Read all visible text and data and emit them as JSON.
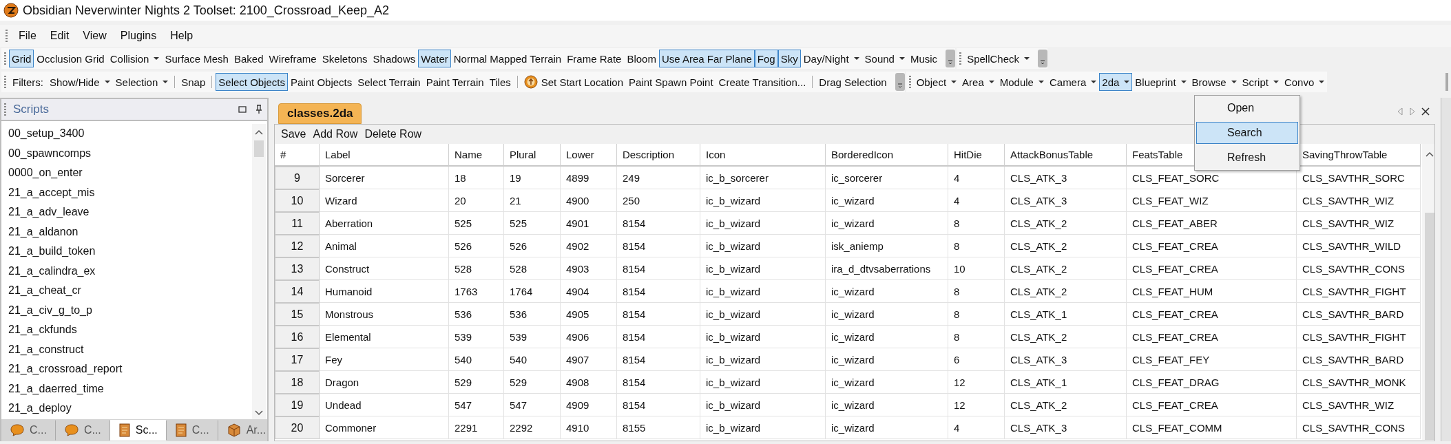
{
  "window": {
    "title": "Obsidian Neverwinter Nights 2 Toolset: 2100_Crossroad_Keep_A2"
  },
  "menu_bar": [
    "File",
    "Edit",
    "View",
    "Plugins",
    "Help"
  ],
  "toolbar_rows": [
    {
      "toolbars": [
        {
          "items": [
            {
              "kind": "toggle",
              "label": "Grid",
              "selected": true
            },
            {
              "kind": "toggle",
              "label": "Occlusion Grid",
              "selected": false
            },
            {
              "kind": "dropdown",
              "label": "Collision",
              "selected": false
            },
            {
              "kind": "toggle",
              "label": "Surface Mesh",
              "selected": false
            },
            {
              "kind": "toggle",
              "label": "Baked",
              "selected": false
            },
            {
              "kind": "toggle",
              "label": "Wireframe",
              "selected": false
            },
            {
              "kind": "toggle",
              "label": "Skeletons",
              "selected": false
            },
            {
              "kind": "toggle",
              "label": "Shadows",
              "selected": false
            },
            {
              "kind": "toggle",
              "label": "Water",
              "selected": true
            },
            {
              "kind": "toggle",
              "label": "Normal Mapped Terrain",
              "selected": false
            },
            {
              "kind": "toggle",
              "label": "Frame Rate",
              "selected": false
            },
            {
              "kind": "toggle",
              "label": "Bloom",
              "selected": false
            },
            {
              "kind": "toggle",
              "label": "Use Area Far Plane",
              "selected": true
            },
            {
              "kind": "toggle",
              "label": "Fog",
              "selected": true
            },
            {
              "kind": "toggle",
              "label": "Sky",
              "selected": true
            },
            {
              "kind": "dropdown",
              "label": "Day/Night",
              "selected": false
            },
            {
              "kind": "dropdown",
              "label": "Sound",
              "selected": false
            },
            {
              "kind": "toggle",
              "label": "Music",
              "selected": false
            },
            {
              "kind": "overflow"
            }
          ]
        },
        {
          "items": [
            {
              "kind": "dropdown",
              "label": "SpellCheck",
              "selected": false
            },
            {
              "kind": "overflow"
            }
          ]
        }
      ]
    },
    {
      "toolbars": [
        {
          "items": [
            {
              "kind": "label",
              "label": "Filters:"
            },
            {
              "kind": "dropdown",
              "label": "Show/Hide",
              "selected": false
            },
            {
              "kind": "dropdown",
              "label": "Selection",
              "selected": false
            },
            {
              "kind": "separator"
            },
            {
              "kind": "toggle",
              "label": "Snap",
              "selected": false
            },
            {
              "kind": "separator"
            },
            {
              "kind": "toggle",
              "label": "Select Objects",
              "selected": true
            },
            {
              "kind": "toggle",
              "label": "Paint Objects",
              "selected": false
            },
            {
              "kind": "toggle",
              "label": "Select Terrain",
              "selected": false
            },
            {
              "kind": "toggle",
              "label": "Paint Terrain",
              "selected": false
            },
            {
              "kind": "toggle",
              "label": "Tiles",
              "selected": false
            },
            {
              "kind": "separator"
            },
            {
              "kind": "icon-button",
              "label": "Set Start Location",
              "selected": false
            },
            {
              "kind": "toggle",
              "label": "Paint Spawn Point",
              "selected": false
            },
            {
              "kind": "toggle",
              "label": "Create Transition...",
              "selected": false
            },
            {
              "kind": "separator"
            },
            {
              "kind": "toggle",
              "label": "Drag Selection",
              "selected": false
            },
            {
              "kind": "overflow"
            }
          ]
        },
        {
          "items": [
            {
              "kind": "dropdown",
              "label": "Object",
              "selected": false
            },
            {
              "kind": "dropdown",
              "label": "Area",
              "selected": false
            },
            {
              "kind": "dropdown",
              "label": "Module",
              "selected": false
            },
            {
              "kind": "dropdown",
              "label": "Camera",
              "selected": false
            },
            {
              "kind": "dropdown",
              "label": "2da",
              "selected": true
            },
            {
              "kind": "dropdown",
              "label": "Blueprint",
              "selected": false
            },
            {
              "kind": "dropdown",
              "label": "Browse",
              "selected": false
            },
            {
              "kind": "dropdown",
              "label": "Script",
              "selected": false
            },
            {
              "kind": "dropdown",
              "label": "Convo",
              "selected": false
            }
          ]
        }
      ]
    }
  ],
  "dropdown_menu": [
    {
      "label": "Open",
      "selected": false
    },
    {
      "label": "Search",
      "selected": true
    },
    {
      "label": "Refresh",
      "selected": false
    }
  ],
  "scripts_panel": {
    "title": "Scripts",
    "items": [
      "00_setup_3400",
      "00_spawncomps",
      "0000_on_enter",
      "21_a_accept_mis",
      "21_a_adv_leave",
      "21_a_aldanon",
      "21_a_build_token",
      "21_a_calindra_ex",
      "21_a_cheat_cr",
      "21_a_civ_g_to_p",
      "21_a_ckfunds",
      "21_a_construct",
      "21_a_crossroad_report",
      "21_a_daerred_time",
      "21_a_deploy"
    ],
    "tabs": [
      {
        "label": "C...",
        "kind": "bubble",
        "selected": false
      },
      {
        "label": "C...",
        "kind": "bubble",
        "selected": false
      },
      {
        "label": "Sc...",
        "kind": "script",
        "selected": true
      },
      {
        "label": "C...",
        "kind": "script",
        "selected": false
      },
      {
        "label": "Ar...",
        "kind": "box",
        "selected": false
      }
    ]
  },
  "document": {
    "tabs": [
      {
        "label": "classes.2da",
        "selected": true
      }
    ],
    "actions": [
      "Save",
      "Add Row",
      "Delete Row"
    ],
    "table": {
      "columns": [
        "#",
        "Label",
        "Name",
        "Plural",
        "Lower",
        "Description",
        "Icon",
        "BorderedIcon",
        "HitDie",
        "AttackBonusTable",
        "FeatsTable",
        "SavingThrowTable"
      ],
      "rows": [
        [
          "9",
          "Sorcerer",
          "18",
          "19",
          "4899",
          "249",
          "ic_b_sorcerer",
          "ic_sorcerer",
          "4",
          "CLS_ATK_3",
          "CLS_FEAT_SORC",
          "CLS_SAVTHR_SORC"
        ],
        [
          "10",
          "Wizard",
          "20",
          "21",
          "4900",
          "250",
          "ic_b_wizard",
          "ic_wizard",
          "4",
          "CLS_ATK_3",
          "CLS_FEAT_WIZ",
          "CLS_SAVTHR_WIZ"
        ],
        [
          "11",
          "Aberration",
          "525",
          "525",
          "4901",
          "8154",
          "ic_b_wizard",
          "ic_wizard",
          "8",
          "CLS_ATK_2",
          "CLS_FEAT_ABER",
          "CLS_SAVTHR_WIZ"
        ],
        [
          "12",
          "Animal",
          "526",
          "526",
          "4902",
          "8154",
          "ic_b_wizard",
          "isk_aniemp",
          "8",
          "CLS_ATK_2",
          "CLS_FEAT_CREA",
          "CLS_SAVTHR_WILD"
        ],
        [
          "13",
          "Construct",
          "528",
          "528",
          "4903",
          "8154",
          "ic_b_wizard",
          "ira_d_dtvsaberrations",
          "10",
          "CLS_ATK_2",
          "CLS_FEAT_CREA",
          "CLS_SAVTHR_CONS"
        ],
        [
          "14",
          "Humanoid",
          "1763",
          "1764",
          "4904",
          "8154",
          "ic_b_wizard",
          "ic_wizard",
          "8",
          "CLS_ATK_2",
          "CLS_FEAT_HUM",
          "CLS_SAVTHR_FIGHT"
        ],
        [
          "15",
          "Monstrous",
          "536",
          "536",
          "4905",
          "8154",
          "ic_b_wizard",
          "ic_wizard",
          "8",
          "CLS_ATK_1",
          "CLS_FEAT_CREA",
          "CLS_SAVTHR_BARD"
        ],
        [
          "16",
          "Elemental",
          "539",
          "539",
          "4906",
          "8154",
          "ic_b_wizard",
          "ic_wizard",
          "8",
          "CLS_ATK_2",
          "CLS_FEAT_CREA",
          "CLS_SAVTHR_FIGHT"
        ],
        [
          "17",
          "Fey",
          "540",
          "540",
          "4907",
          "8154",
          "ic_b_wizard",
          "ic_wizard",
          "6",
          "CLS_ATK_3",
          "CLS_FEAT_FEY",
          "CLS_SAVTHR_BARD"
        ],
        [
          "18",
          "Dragon",
          "529",
          "529",
          "4908",
          "8154",
          "ic_b_wizard",
          "ic_wizard",
          "12",
          "CLS_ATK_1",
          "CLS_FEAT_DRAG",
          "CLS_SAVTHR_MONK"
        ],
        [
          "19",
          "Undead",
          "547",
          "547",
          "4909",
          "8154",
          "ic_b_wizard",
          "ic_wizard",
          "12",
          "CLS_ATK_2",
          "CLS_FEAT_CREA",
          "CLS_SAVTHR_WIZ"
        ],
        [
          "20",
          "Commoner",
          "2291",
          "2292",
          "4910",
          "8155",
          "ic_b_wizard",
          "ic_wizard",
          "4",
          "CLS_ATK_3",
          "CLS_FEAT_COMM",
          "CLS_SAVTHR_CONS"
        ]
      ]
    }
  }
}
